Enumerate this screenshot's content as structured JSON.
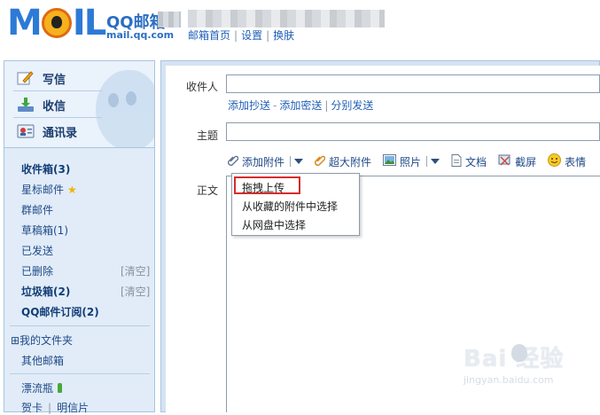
{
  "header": {
    "logo_text": "MOIL",
    "brand_title": "QQ邮箱",
    "brand_url": "mail.qq.com",
    "links": [
      "邮箱首页",
      "设置",
      "换肤"
    ],
    "link_separator": "|"
  },
  "sidebar": {
    "actions": [
      {
        "label": "写信",
        "icon": "pencil-note-icon"
      },
      {
        "label": "收信",
        "icon": "download-tray-icon"
      },
      {
        "label": "通讯录",
        "icon": "contact-card-icon"
      }
    ],
    "folders": [
      {
        "label": "收件箱(3)",
        "bold": true
      },
      {
        "label": "星标邮件",
        "icon": "star-icon"
      },
      {
        "label": "群邮件"
      },
      {
        "label": "草稿箱(1)"
      },
      {
        "label": "已发送"
      },
      {
        "label": "已删除",
        "action": "[清空]"
      },
      {
        "label": "垃圾箱(2)",
        "bold": true,
        "action": "[清空]"
      },
      {
        "label": "QQ邮件订阅(2)",
        "bold": true
      }
    ],
    "my_folders": "⊞我的文件夹",
    "other_mailbox": "其他邮箱",
    "drift_bottle": "漂流瓶",
    "cards": [
      "贺卡",
      "明信片"
    ],
    "card_separator": "|"
  },
  "compose": {
    "to_label": "收件人",
    "cc_links": [
      "添加抄送",
      "添加密送",
      "分别发送"
    ],
    "cc_sep_dash": "-",
    "cc_sep_bar": "|",
    "subject_label": "主题",
    "body_label": "正文",
    "toolbar": [
      {
        "label": "添加附件",
        "icon": "paperclip-icon",
        "dropdown": true
      },
      {
        "label": "超大附件",
        "icon": "paperclip-large-icon"
      },
      {
        "label": "照片",
        "icon": "photo-icon",
        "dropdown": true
      },
      {
        "label": "文档",
        "icon": "document-icon"
      },
      {
        "label": "截屏",
        "icon": "screenshot-icon"
      },
      {
        "label": "表情",
        "icon": "smiley-icon"
      }
    ]
  },
  "attach_menu": {
    "items": [
      "拖拽上传",
      "从收藏的附件中选择",
      "从网盘中选择"
    ],
    "highlight_color": "#d92b2b"
  },
  "watermark": {
    "brand": "Bai 经验",
    "url": "jingyan.baidu.com"
  },
  "colors": {
    "link": "#2160b8",
    "nav_bg": "#e1ecf8",
    "border": "#a9c3e0",
    "logo_blue": "#2d7ad6"
  }
}
